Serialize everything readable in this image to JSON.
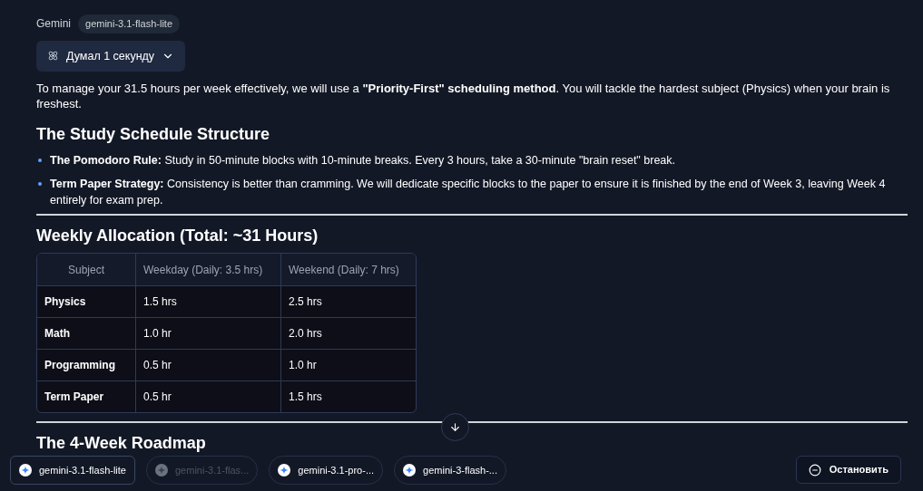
{
  "header": {
    "provider": "Gemini",
    "model": "gemini-3.1-flash-lite"
  },
  "thinking": {
    "label": "Думал 1 секунду",
    "expanded": false
  },
  "intro": "To manage your 31.5 hours per week effectively, we will use a **\"Priority-First\" scheduling method**. You will tackle the hardest subject (Physics) when your brain is freshest.",
  "section_1": {
    "heading": "The Study Schedule Structure",
    "bullets": [
      {
        "term": "The Pomodoro Rule:",
        "text": "Study in 50-minute blocks with 10-minute breaks. Every 3 hours, take a 30-minute \"brain reset\" break."
      },
      {
        "term": "Term Paper Strategy:",
        "text": "Consistency is better than cramming. We will dedicate specific blocks to the paper to ensure it is finished by the end of Week 3, leaving Week 4 entirely for exam prep."
      }
    ]
  },
  "section_2": {
    "heading": "Weekly Allocation (Total: ~31 Hours)",
    "table": {
      "columns": [
        "Subject",
        "Weekday (Daily: 3.5 hrs)",
        "Weekend (Daily: 7 hrs)"
      ],
      "rows": [
        [
          "Physics",
          "1.5 hrs",
          "2.5 hrs"
        ],
        [
          "Math",
          "1.0 hr",
          "2.0 hrs"
        ],
        [
          "Programming",
          "0.5 hr",
          "1.0 hr"
        ],
        [
          "Term Paper",
          "0.5 hr",
          "1.5 hrs"
        ]
      ]
    }
  },
  "section_3": {
    "heading": "The 4-Week Roadmap"
  },
  "model_chips": [
    {
      "label": "gemini-3.1-flash-lite",
      "selected": true,
      "disabled": false
    },
    {
      "label": "gemini-3.1-flas...",
      "selected": false,
      "disabled": true
    },
    {
      "label": "gemini-3.1-pro-...",
      "selected": false,
      "disabled": false
    },
    {
      "label": "gemini-3-flash-...",
      "selected": false,
      "disabled": false
    }
  ],
  "stop_button": "Остановить"
}
